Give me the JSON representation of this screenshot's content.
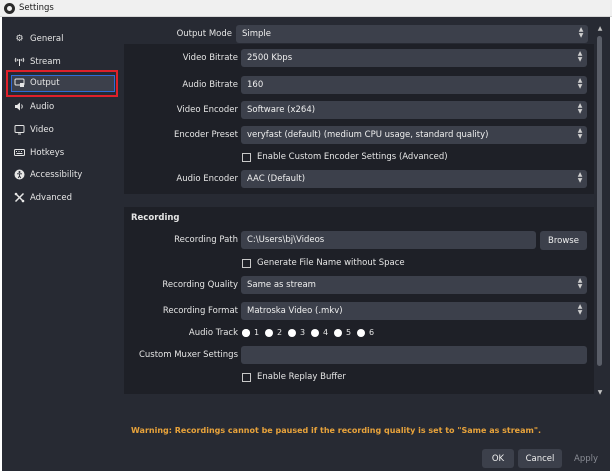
{
  "window": {
    "title": "Settings"
  },
  "sidebar": {
    "items": [
      {
        "label": "General",
        "icon": "gear-icon"
      },
      {
        "label": "Stream",
        "icon": "antenna-icon"
      },
      {
        "label": "Output",
        "icon": "output-icon"
      },
      {
        "label": "Audio",
        "icon": "speaker-icon"
      },
      {
        "label": "Video",
        "icon": "monitor-icon"
      },
      {
        "label": "Hotkeys",
        "icon": "keyboard-icon"
      },
      {
        "label": "Accessibility",
        "icon": "accessibility-icon"
      },
      {
        "label": "Advanced",
        "icon": "tools-icon"
      }
    ],
    "selected": "Output"
  },
  "output": {
    "mode_label": "Output Mode",
    "mode_value": "Simple"
  },
  "streaming": {
    "video_bitrate_label": "Video Bitrate",
    "video_bitrate_value": "2500 Kbps",
    "audio_bitrate_label": "Audio Bitrate",
    "audio_bitrate_value": "160",
    "video_encoder_label": "Video Encoder",
    "video_encoder_value": "Software (x264)",
    "encoder_preset_label": "Encoder Preset",
    "encoder_preset_value": "veryfast (default) (medium CPU usage, standard quality)",
    "custom_encoder_label": "Enable Custom Encoder Settings (Advanced)",
    "audio_encoder_label": "Audio Encoder",
    "audio_encoder_value": "AAC (Default)"
  },
  "recording": {
    "heading": "Recording",
    "path_label": "Recording Path",
    "path_value": "C:\\Users\\bj\\Videos",
    "browse_label": "Browse",
    "gen_filename_label": "Generate File Name without Space",
    "quality_label": "Recording Quality",
    "quality_value": "Same as stream",
    "format_label": "Recording Format",
    "format_value": "Matroska Video (.mkv)",
    "audio_track_label": "Audio Track",
    "audio_tracks": [
      "1",
      "2",
      "3",
      "4",
      "5",
      "6"
    ],
    "custom_muxer_label": "Custom Muxer Settings",
    "custom_muxer_value": "",
    "replay_buffer_label": "Enable Replay Buffer"
  },
  "warning": {
    "text": "Warning: Recordings cannot be paused if the recording quality is set to \"Same as stream\".",
    "color": "#e8a33b"
  },
  "footer": {
    "ok_label": "OK",
    "cancel_label": "Cancel",
    "apply_label": "Apply"
  },
  "colors": {
    "window_bg": "#272a33",
    "panel_bg": "#1e2027",
    "field_bg": "#3c404b",
    "selection_outline": "#e0202a",
    "selection_border": "#2f6bd8"
  }
}
